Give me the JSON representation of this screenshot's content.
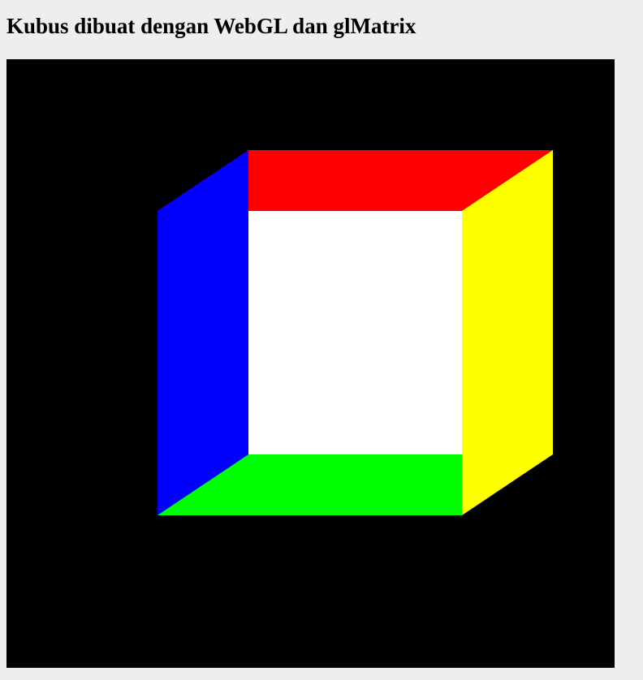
{
  "page": {
    "title": "Kubus dibuat dengan WebGL dan glMatrix"
  },
  "canvas": {
    "background": "#000000",
    "cube_faces": [
      {
        "name": "cube-face-back",
        "color": "#ffffff"
      },
      {
        "name": "cube-face-top",
        "color": "#ff0000"
      },
      {
        "name": "cube-face-left",
        "color": "#0000ff"
      },
      {
        "name": "cube-face-right",
        "color": "#ffff00"
      },
      {
        "name": "cube-face-bottom",
        "color": "#00ff00"
      }
    ]
  }
}
